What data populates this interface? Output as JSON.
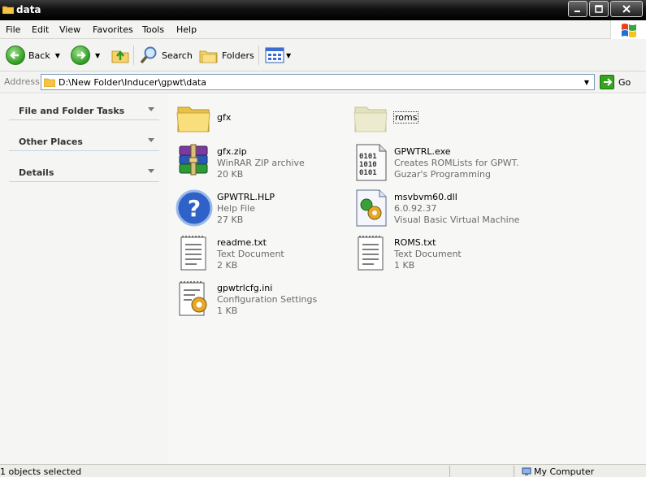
{
  "window": {
    "title": "data"
  },
  "menu": [
    "File",
    "Edit",
    "View",
    "Favorites",
    "Tools",
    "Help"
  ],
  "toolbar": {
    "back": "Back",
    "search": "Search",
    "folders": "Folders"
  },
  "address": {
    "label": "Address",
    "path": "D:\\New Folder\\Inducer\\gpwt\\data",
    "go": "Go"
  },
  "tasks": [
    "File and Folder Tasks",
    "Other Places",
    "Details"
  ],
  "files": [
    {
      "name": "gfx",
      "type": "folder"
    },
    {
      "name": "roms",
      "type": "folder-selected"
    },
    {
      "name": "gfx.zip",
      "desc": "WinRAR ZIP archive",
      "size": "20 KB",
      "icon": "winrar-archive-icon"
    },
    {
      "name": "GPWTRL.exe",
      "desc": "Creates ROMLists for GPWT.",
      "size": "Guzar's Programming",
      "icon": "executable-icon"
    },
    {
      "name": "GPWTRL.HLP",
      "desc": "Help File",
      "size": "27 KB",
      "icon": "help-file-icon"
    },
    {
      "name": "msvbvm60.dll",
      "desc": "6.0.92.37",
      "size": "Visual Basic Virtual Machine",
      "icon": "dll-file-icon"
    },
    {
      "name": "readme.txt",
      "desc": "Text Document",
      "size": "2 KB",
      "icon": "text-document-icon"
    },
    {
      "name": "ROMS.txt",
      "desc": "Text Document",
      "size": "1 KB",
      "icon": "text-document-icon"
    },
    {
      "name": "gpwtrlcfg.ini",
      "desc": "Configuration Settings",
      "size": "1 KB",
      "icon": "config-settings-icon"
    }
  ],
  "status": {
    "left": "1 objects selected",
    "right": "My Computer"
  }
}
